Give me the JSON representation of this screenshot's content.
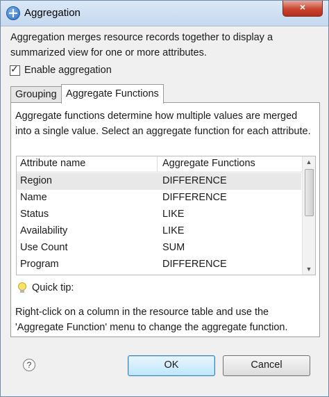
{
  "window": {
    "title": "Aggregation",
    "close_symbol": "×"
  },
  "intro_text": "Aggregation merges resource records together to display a summarized view for one or more attributes.",
  "enable_checkbox": {
    "label": "Enable aggregation",
    "checked": true
  },
  "tabs": [
    {
      "label": "Grouping",
      "active": false
    },
    {
      "label": "Aggregate Functions",
      "active": true
    }
  ],
  "panel": {
    "description": "Aggregate functions determine how multiple values are merged into a single value. Select an aggregate function for each attribute.",
    "table": {
      "columns": [
        "Attribute name",
        "Aggregate Functions"
      ],
      "rows": [
        [
          "Region",
          "DIFFERENCE"
        ],
        [
          "Name",
          "DIFFERENCE"
        ],
        [
          "Status",
          "LIKE"
        ],
        [
          "Availability",
          "LIKE"
        ],
        [
          "Use Count",
          "SUM"
        ],
        [
          "Program",
          "DIFFERENCE"
        ]
      ],
      "selected_row": 0
    },
    "quick_tip": {
      "label": "Quick tip:",
      "text": "Right-click on a column in the resource table and use the 'Aggregate Function' menu to change the aggregate function."
    }
  },
  "buttons": {
    "ok": "OK",
    "cancel": "Cancel",
    "help": "?"
  },
  "icons": [
    "app-plus-icon",
    "close-icon",
    "checkbox-check-icon",
    "scroll-up-arrow-icon",
    "scroll-down-arrow-icon",
    "lightbulb-icon",
    "help-icon"
  ],
  "colors": {
    "title_bar": "#c6d9ef",
    "close_button": "#c8442f",
    "default_button": "#bee6fd",
    "selected_row": "#e8e8e8"
  }
}
